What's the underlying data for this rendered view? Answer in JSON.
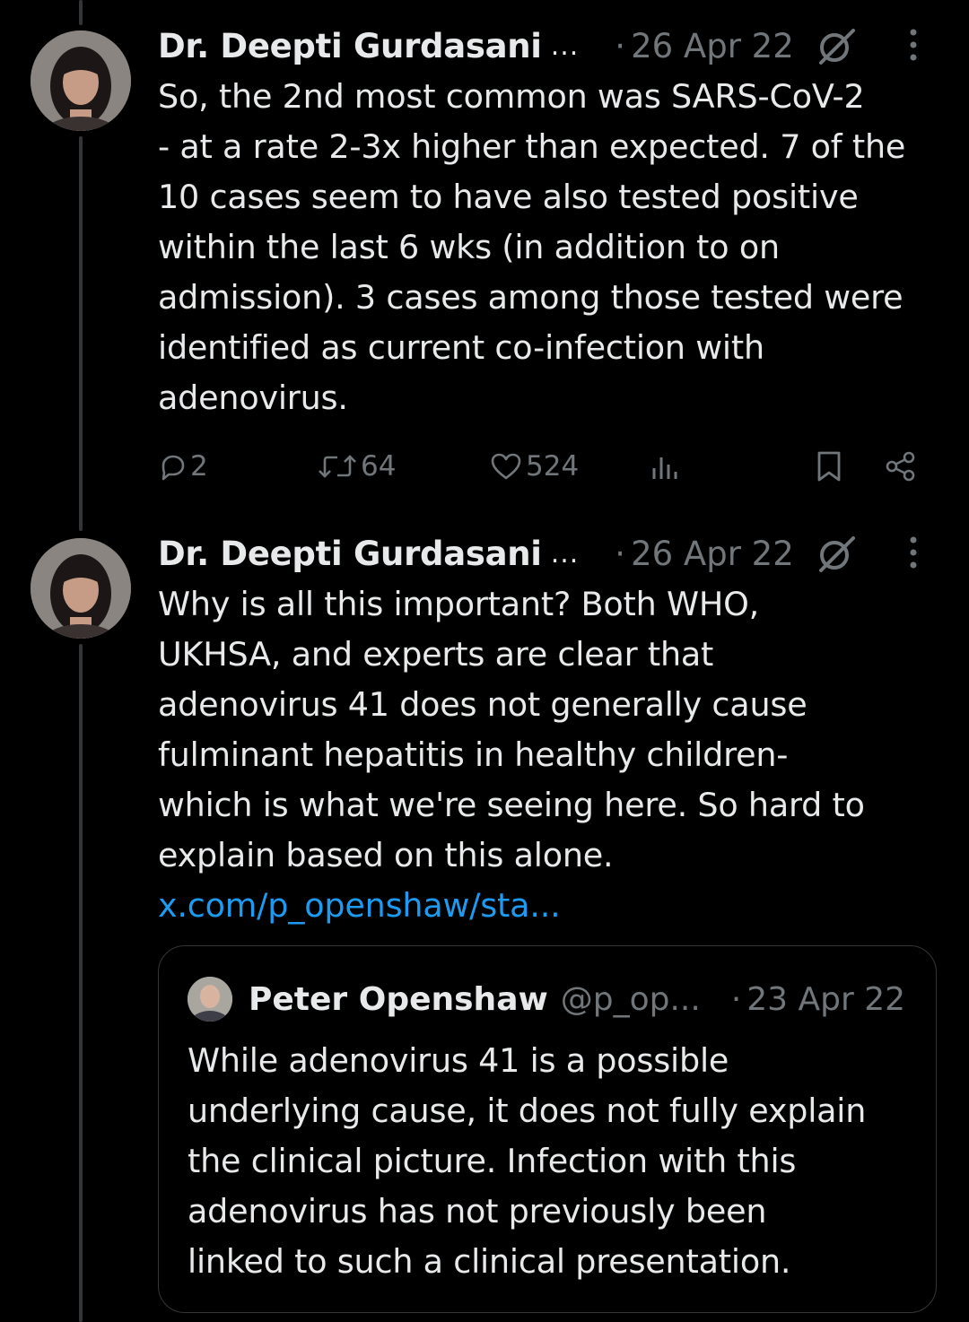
{
  "tweets": [
    {
      "author_name": "Dr. Deepti Gurdasani",
      "truncation": "...",
      "separator": "·",
      "date": "26 Apr 22",
      "text_lines": [
        "So, the 2nd most common was SARS-CoV-2",
        "- at a rate 2-3x higher than expected. 7 of the",
        "10 cases seem to have also tested positive",
        "within the last 6 wks (in addition to on",
        "admission). 3 cases among those tested were",
        "identified as current co-infection with",
        "adenovirus."
      ],
      "replies": "2",
      "reposts": "64",
      "likes": "524"
    },
    {
      "author_name": "Dr. Deepti Gurdasani",
      "truncation": "...",
      "separator": "·",
      "date": "26 Apr 22",
      "text_lines": [
        "Why is all this important? Both WHO,",
        "UKHSA, and experts are clear that",
        "adenovirus 41 does not generally cause",
        "fulminant hepatitis in healthy children-",
        "which is what we're seeing here. So hard to",
        "explain based on this alone."
      ],
      "link": "x.com/p_openshaw/sta..."
    }
  ],
  "quote": {
    "author_name": "Peter Openshaw",
    "handle": "@p_op...",
    "separator": "·",
    "date": "23 Apr 22",
    "text_lines": [
      "While adenovirus 41 is a possible",
      "underlying cause, it does not fully explain",
      "the clinical picture. Infection with this",
      "adenovirus has not previously been",
      "linked to such a clinical presentation."
    ]
  },
  "icons": {
    "reply": "reply-icon",
    "repost": "repost-icon",
    "like": "heart-icon",
    "views": "views-icon",
    "bookmark": "bookmark-icon",
    "share": "share-icon",
    "grok": "grok-icon",
    "more": "more-icon"
  },
  "colors": {
    "background": "#000000",
    "text": "#e7e9ea",
    "muted": "#71767b",
    "link": "#1d9bf0",
    "border": "#333639"
  }
}
